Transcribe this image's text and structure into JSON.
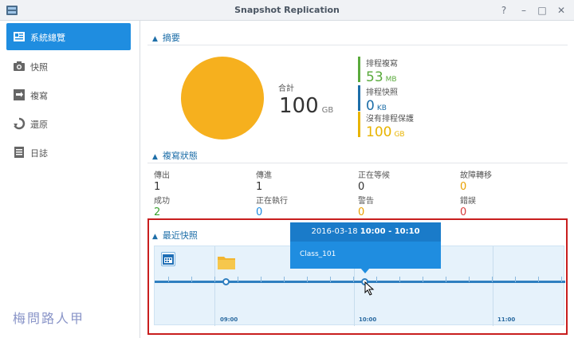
{
  "window": {
    "title": "Snapshot Replication",
    "help": "?",
    "minimize": "–",
    "maximize": "□",
    "close": "✕"
  },
  "sidebar": {
    "items": [
      {
        "label": "系統總覽",
        "icon": "overview-icon",
        "active": true
      },
      {
        "label": "快照",
        "icon": "camera-icon"
      },
      {
        "label": "複寫",
        "icon": "replication-icon"
      },
      {
        "label": "還原",
        "icon": "restore-icon"
      },
      {
        "label": "日誌",
        "icon": "log-icon"
      }
    ]
  },
  "summary": {
    "title": "摘要",
    "total_label": "合計",
    "total_value": "100",
    "total_unit": "GB",
    "legend": [
      {
        "name": "排程複寫",
        "value": "53",
        "unit": "MB",
        "color": "#5aaa3c"
      },
      {
        "name": "排程快照",
        "value": "0",
        "unit": "KB",
        "color": "#1d6ea8"
      },
      {
        "name": "沒有排程保護",
        "value": "100",
        "unit": "GB",
        "color": "#e8b400"
      }
    ],
    "pie_color": "#f6b01e"
  },
  "replication_status": {
    "title": "複寫狀態",
    "cells": [
      {
        "label": "傳出",
        "value": "1",
        "color": "#333333"
      },
      {
        "label": "傳進",
        "value": "1",
        "color": "#333333"
      },
      {
        "label": "正在等候",
        "value": "0",
        "color": "#333333"
      },
      {
        "label": "故障轉移",
        "value": "0",
        "color": "#e8a000"
      },
      {
        "label": "成功",
        "value": "2",
        "color": "#3aa22e"
      },
      {
        "label": "正在執行",
        "value": "0",
        "color": "#1d8be0"
      },
      {
        "label": "警告",
        "value": "0",
        "color": "#e8a000"
      },
      {
        "label": "錯誤",
        "value": "0",
        "color": "#d63a3a"
      }
    ]
  },
  "recent_snapshots": {
    "title": "最近快照",
    "hours": [
      "09:00",
      "10:00",
      "11:00"
    ],
    "popup": {
      "date": "2016-03-18",
      "time_range": "10:00 - 10:10",
      "name": "Class_101"
    }
  },
  "watermark": "梅問路人甲"
}
